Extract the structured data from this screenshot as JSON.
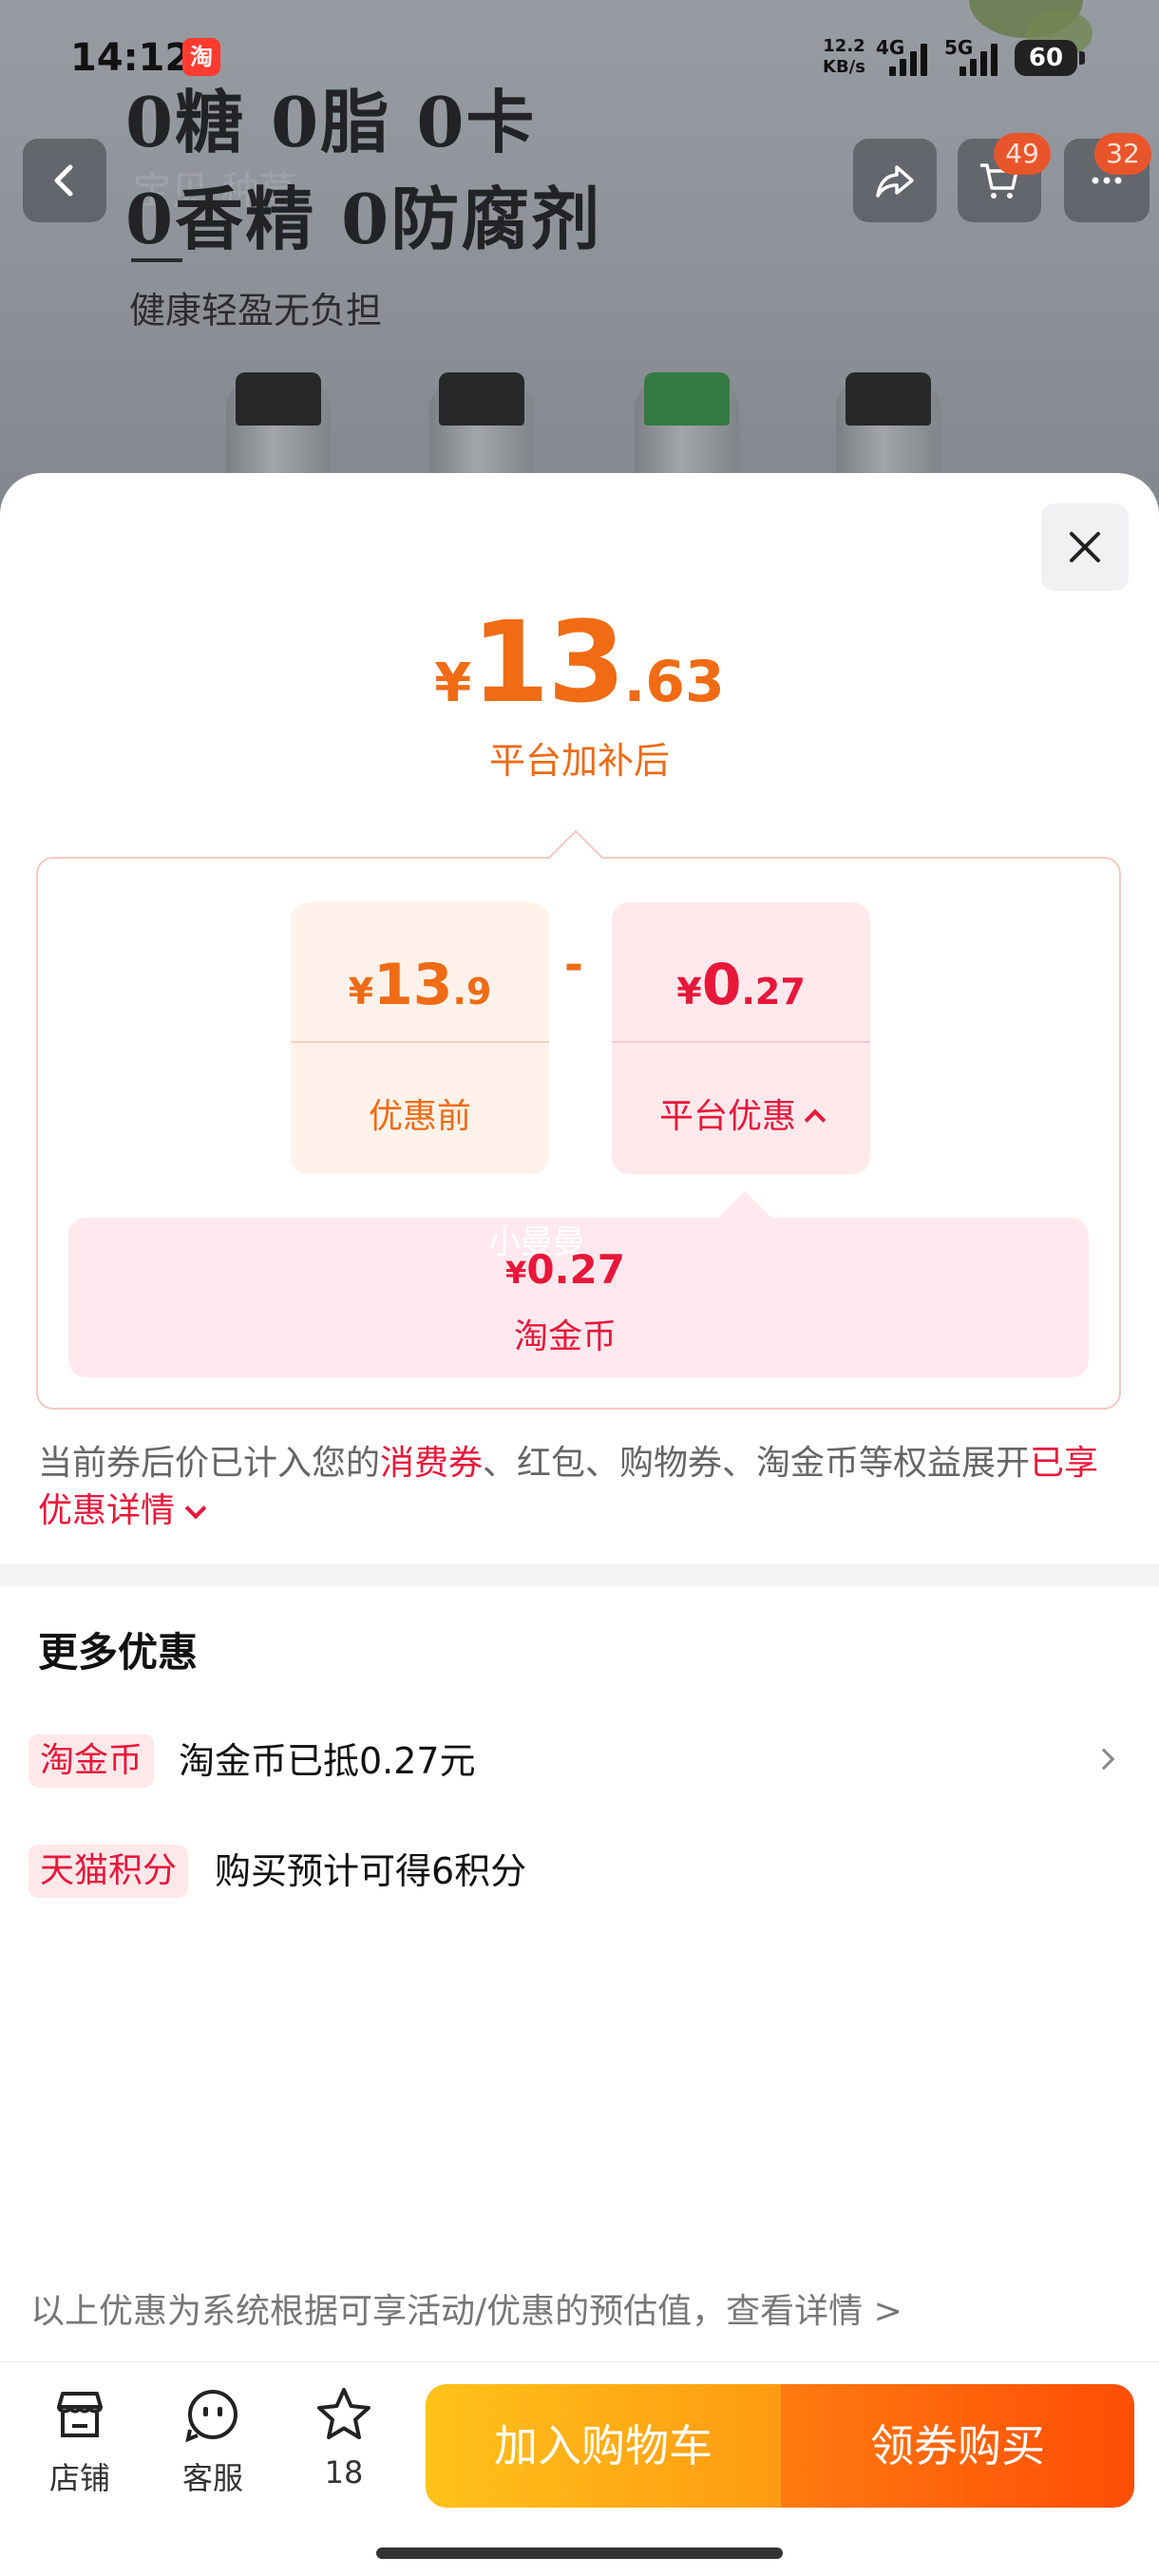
{
  "status_bar": {
    "time": "14:12",
    "app_badge": "淘",
    "net_speed": "12.2",
    "net_unit": "KB/s",
    "sig1": "4G",
    "sig2": "5G",
    "battery": "60"
  },
  "banner": {
    "line1": "0糖  0脂  0卡",
    "line2": "0香精  0防腐剂",
    "subline": "健康轻盈无负担",
    "ghost": "宝贝  种草"
  },
  "nav": {
    "cart_count": "49",
    "more_count": "32"
  },
  "price": {
    "currency": "¥",
    "final_int": "13",
    "final_dec": ".63",
    "final_label": "平台加补后",
    "original_int": "13",
    "original_dec": ".9",
    "original_label": "优惠前",
    "minus": "-",
    "platform_int": "0",
    "platform_dec": ".27",
    "platform_label": "平台优惠",
    "sub_ghost": "小曼曼",
    "sub_value": "0.27",
    "sub_label": "淘金币"
  },
  "note": {
    "part1": "当前券后价已计入您的",
    "highlight1": "消费券",
    "part2": "、红包、购物券、淘金币等权益展开",
    "highlight2": "已享优惠详情"
  },
  "more": {
    "title": "更多优惠",
    "rows": [
      {
        "tag": "淘金币",
        "text": "淘金币已抵0.27元"
      },
      {
        "tag": "天猫积分",
        "text": "购买预计可得6积分"
      }
    ]
  },
  "disclaimer": "以上优惠为系统根据可享活动/优惠的预估值，查看详情 >",
  "bottom_bar": {
    "store": "店铺",
    "service": "客服",
    "favorites": "18",
    "add_cart": "加入购物车",
    "buy": "领券购买"
  },
  "colors": {
    "price_orange": "#f06b14",
    "discount_red": "#e8173a",
    "cart_button": "#ffb014",
    "buy_button": "#ff5a0a"
  }
}
